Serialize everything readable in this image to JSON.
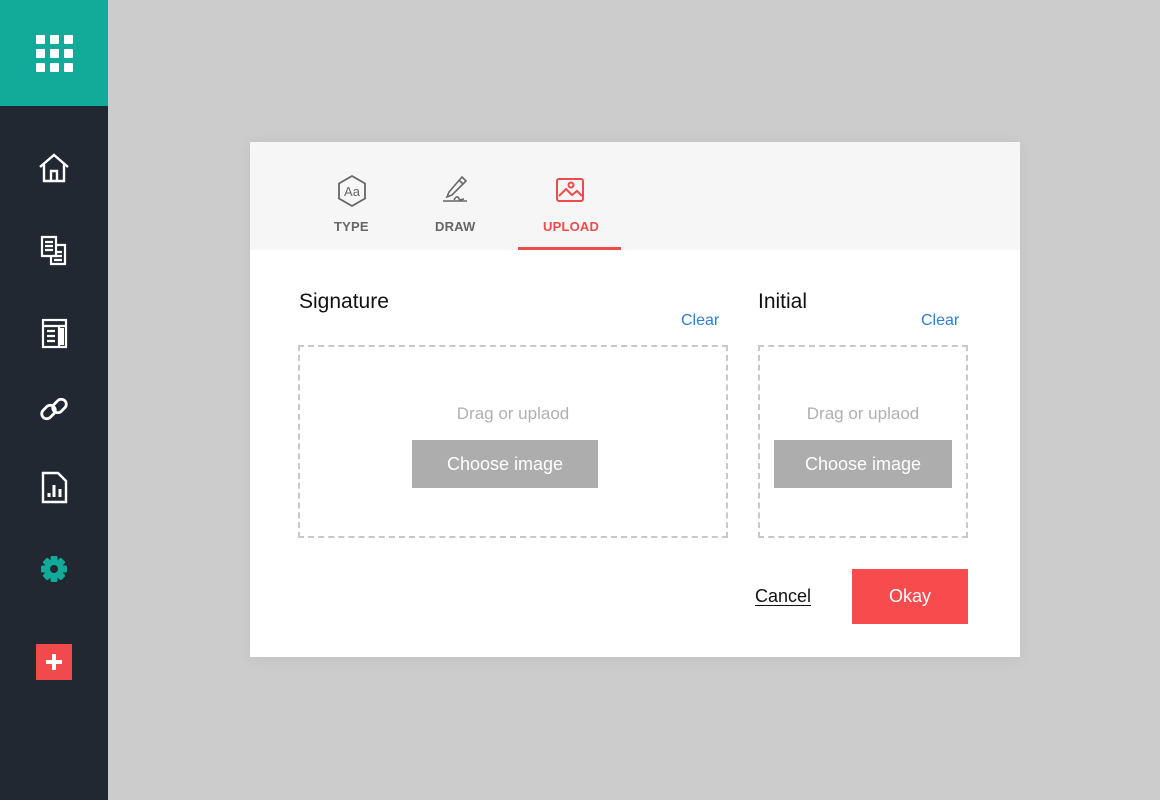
{
  "sidebar": {
    "apps_icon": "apps-grid-icon",
    "items": [
      {
        "name": "home",
        "icon": "home-icon"
      },
      {
        "name": "documents",
        "icon": "documents-icon"
      },
      {
        "name": "templates",
        "icon": "template-icon"
      },
      {
        "name": "links",
        "icon": "link-icon"
      },
      {
        "name": "reports",
        "icon": "report-icon"
      },
      {
        "name": "settings",
        "icon": "gear-icon",
        "active": true
      },
      {
        "name": "add",
        "icon": "plus-icon"
      }
    ],
    "colors": {
      "background": "#222831",
      "apps_tile": "#12ab9a",
      "active_icon": "#12ab9a",
      "add_button": "#f04a4c"
    }
  },
  "dialog": {
    "tabs": [
      {
        "label": "TYPE",
        "icon": "type-aa-icon",
        "active": false
      },
      {
        "label": "DRAW",
        "icon": "pen-draw-icon",
        "active": false
      },
      {
        "label": "UPLOAD",
        "icon": "image-upload-icon",
        "active": true
      }
    ],
    "signature": {
      "title": "Signature",
      "clear_label": "Clear",
      "hint": "Drag or uplaod",
      "button_label": "Choose image"
    },
    "initial": {
      "title": "Initial",
      "clear_label": "Clear",
      "hint": "Drag or uplaod",
      "button_label": "Choose image"
    },
    "footer": {
      "cancel_label": "Cancel",
      "okay_label": "Okay"
    },
    "colors": {
      "accent": "#f04a4c",
      "link": "#2d7fd3",
      "button_gray": "#adadad"
    }
  }
}
